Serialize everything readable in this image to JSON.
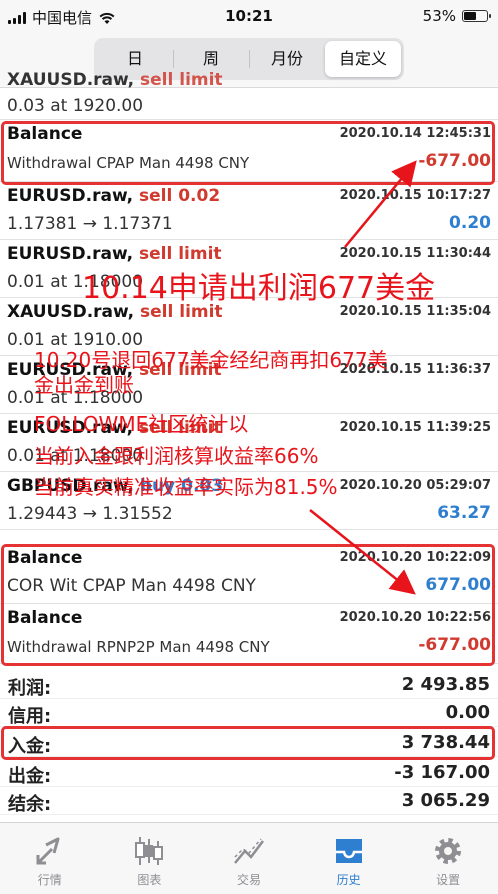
{
  "status_bar": {
    "carrier": "中国电信",
    "time": "10:21",
    "battery": "53%",
    "battery_level": 0.53
  },
  "segments": [
    {
      "label": "日",
      "active": false
    },
    {
      "label": "周",
      "active": false
    },
    {
      "label": "月份",
      "active": false
    },
    {
      "label": "自定义",
      "active": true
    }
  ],
  "rows": {
    "r0": {
      "symbol": "XAUUSD.raw,",
      "order": "sell limit",
      "sub": "0.03 at 1920.00"
    },
    "r1": {
      "symbol": "Balance",
      "date": "2020.10.14 12:45:31",
      "sub": "Withdrawal CPAP Man 4498 CNY",
      "amount": "-677.00"
    },
    "r2": {
      "symbol": "EURUSD.raw,",
      "order": "sell 0.02",
      "date": "2020.10.15 10:17:27",
      "sub": "1.17381 → 1.17371",
      "amount": "0.20"
    },
    "r3": {
      "symbol": "EURUSD.raw,",
      "order": "sell limit",
      "date": "2020.10.15 11:30:44",
      "sub": "0.01 at 1.18000"
    },
    "r4": {
      "symbol": "XAUUSD.raw,",
      "order": "sell limit",
      "date": "2020.10.15 11:35:04",
      "sub": "0.01 at 1910.00"
    },
    "r5": {
      "symbol": "EURUSD.raw,",
      "order": "sell limit",
      "date": "2020.10.15 11:36:37",
      "sub": "0.01 at 1.18000"
    },
    "r6": {
      "symbol": "EURUSD.raw,",
      "order": "sell limit",
      "date": "2020.10.15 11:39:25",
      "sub": "0.01 at 1.18000"
    },
    "r7": {
      "symbol": "GBPUSD.raw,",
      "order": "buy 0.03",
      "date": "2020.10.20 05:29:07",
      "sub": "1.29443 → 1.31552",
      "amount": "63.27"
    },
    "r8": {
      "symbol": "Balance",
      "date": "2020.10.20 10:22:09",
      "sub": "COR Wit CPAP Man 4498 CNY",
      "amount": "677.00"
    },
    "r9": {
      "symbol": "Balance",
      "date": "2020.10.20 10:22:56",
      "sub": "Withdrawal RPNP2P Man 4498 CNY",
      "amount": "-677.00"
    }
  },
  "summary": {
    "profit": {
      "label": "利润:",
      "value": "2 493.85"
    },
    "credit": {
      "label": "信用:",
      "value": "0.00"
    },
    "deposit": {
      "label": "入金:",
      "value": "3 738.44"
    },
    "withdrawal": {
      "label": "出金:",
      "value": "-3 167.00"
    },
    "balance": {
      "label": "结余:",
      "value": "3 065.29"
    }
  },
  "annotations": {
    "a1": "10.14申请出利润677美金",
    "a2": "10.20号退回677美金经纪商再扣677美",
    "a3": "金出金到账",
    "a4": "FOLLOWME社区统计以",
    "a5": "当前入金跟利润核算收益率66%",
    "a6": "当前真实精准收益率实际为81.5%"
  },
  "tabs": [
    {
      "label": "行情",
      "icon": "quotes-icon",
      "active": false
    },
    {
      "label": "图表",
      "icon": "candlestick-chart-icon",
      "active": false
    },
    {
      "label": "交易",
      "icon": "trade-icon",
      "active": false
    },
    {
      "label": "历史",
      "icon": "history-inbox-icon",
      "active": true
    },
    {
      "label": "设置",
      "icon": "gear-icon",
      "active": false
    }
  ],
  "colors": {
    "sell": "#d03a2f",
    "buy": "#2f7fd0",
    "annotation": "#e8141b",
    "highlight_box": "#e53232",
    "active_tab": "#2f7fd0"
  }
}
